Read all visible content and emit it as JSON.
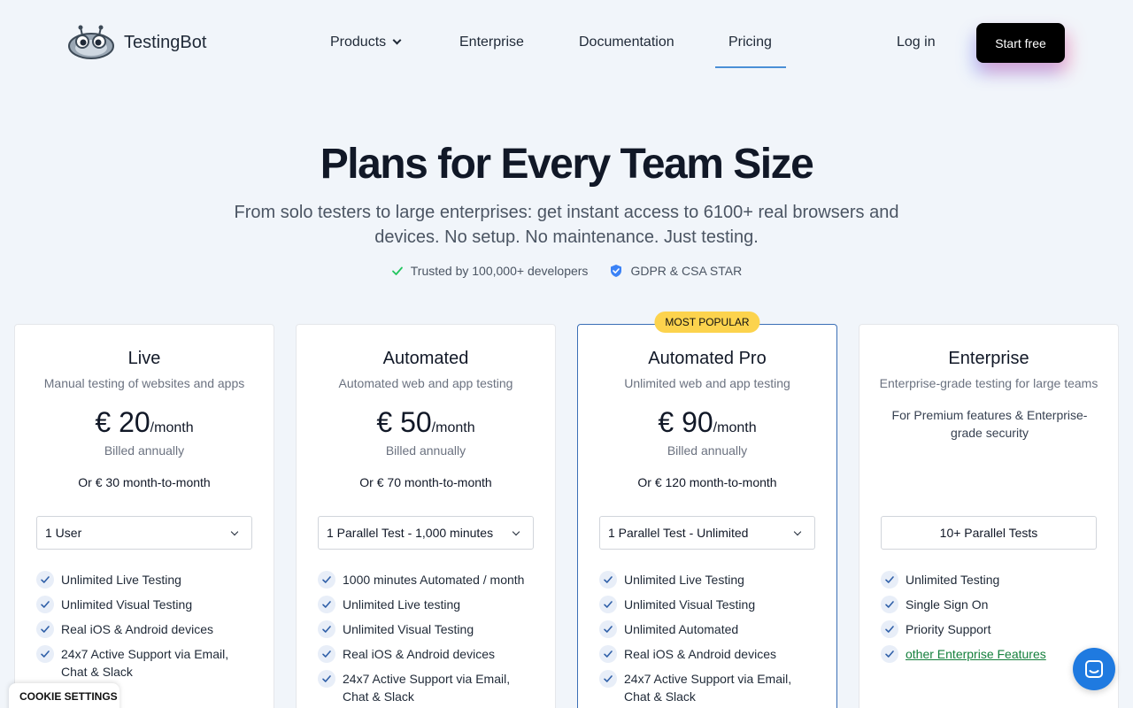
{
  "brand": {
    "name": "TestingBot",
    "icon": "robot-logo-icon"
  },
  "nav": {
    "products": "Products",
    "enterprise": "Enterprise",
    "documentation": "Documentation",
    "pricing": "Pricing",
    "login": "Log in",
    "start_free": "Start free"
  },
  "hero": {
    "title": "Plans for Every Team Size",
    "subtitle": "From solo testers to large enterprises: get instant access to 6100+ real browsers and devices. No setup. No maintenance. Just testing.",
    "trust_1": "Trusted by 100,000+ developers",
    "trust_2": "GDPR & CSA STAR"
  },
  "plans": [
    {
      "name": "Live",
      "desc": "Manual testing of websites and apps",
      "price": "€ 20",
      "per": "/month",
      "billed": "Billed annually",
      "monthly": "Or  € 30 month-to-month",
      "select": "1 User",
      "features": [
        "Unlimited Live Testing",
        "Unlimited Visual Testing",
        "Real iOS & Android devices",
        "24x7 Active Support via Email, Chat & Slack"
      ]
    },
    {
      "name": "Automated",
      "desc": "Automated web and app testing",
      "price": "€ 50",
      "per": "/month",
      "billed": "Billed annually",
      "monthly": "Or  € 70 month-to-month",
      "select": "1 Parallel Test - 1,000 minutes",
      "features": [
        "1000 minutes Automated / month",
        "Unlimited Live testing",
        "Unlimited Visual Testing",
        "Real iOS & Android devices",
        "24x7 Active Support via Email, Chat & Slack"
      ]
    },
    {
      "name": "Automated Pro",
      "badge": "MOST POPULAR",
      "desc": "Unlimited web and app testing",
      "price": "€ 90",
      "per": "/month",
      "billed": "Billed annually",
      "monthly": "Or  € 120 month-to-month",
      "select": "1 Parallel Test - Unlimited",
      "features": [
        "Unlimited Live Testing",
        "Unlimited Visual Testing",
        "Unlimited Automated",
        "Real iOS & Android devices",
        "24x7 Active Support via Email, Chat & Slack"
      ]
    },
    {
      "name": "Enterprise",
      "desc": "Enterprise-grade testing for large teams",
      "note": "For Premium features & Enterprise-grade security",
      "select": "10+ Parallel Tests",
      "features": [
        "Unlimited Testing",
        "Single Sign On",
        "Priority Support"
      ],
      "link": "other Enterprise Features"
    }
  ],
  "cookie": "COOKIE SETTINGS",
  "colors": {
    "accent": "#4a8fd6",
    "badge": "#fcd34d",
    "chat": "#1f7ae0",
    "link": "#15803d"
  }
}
